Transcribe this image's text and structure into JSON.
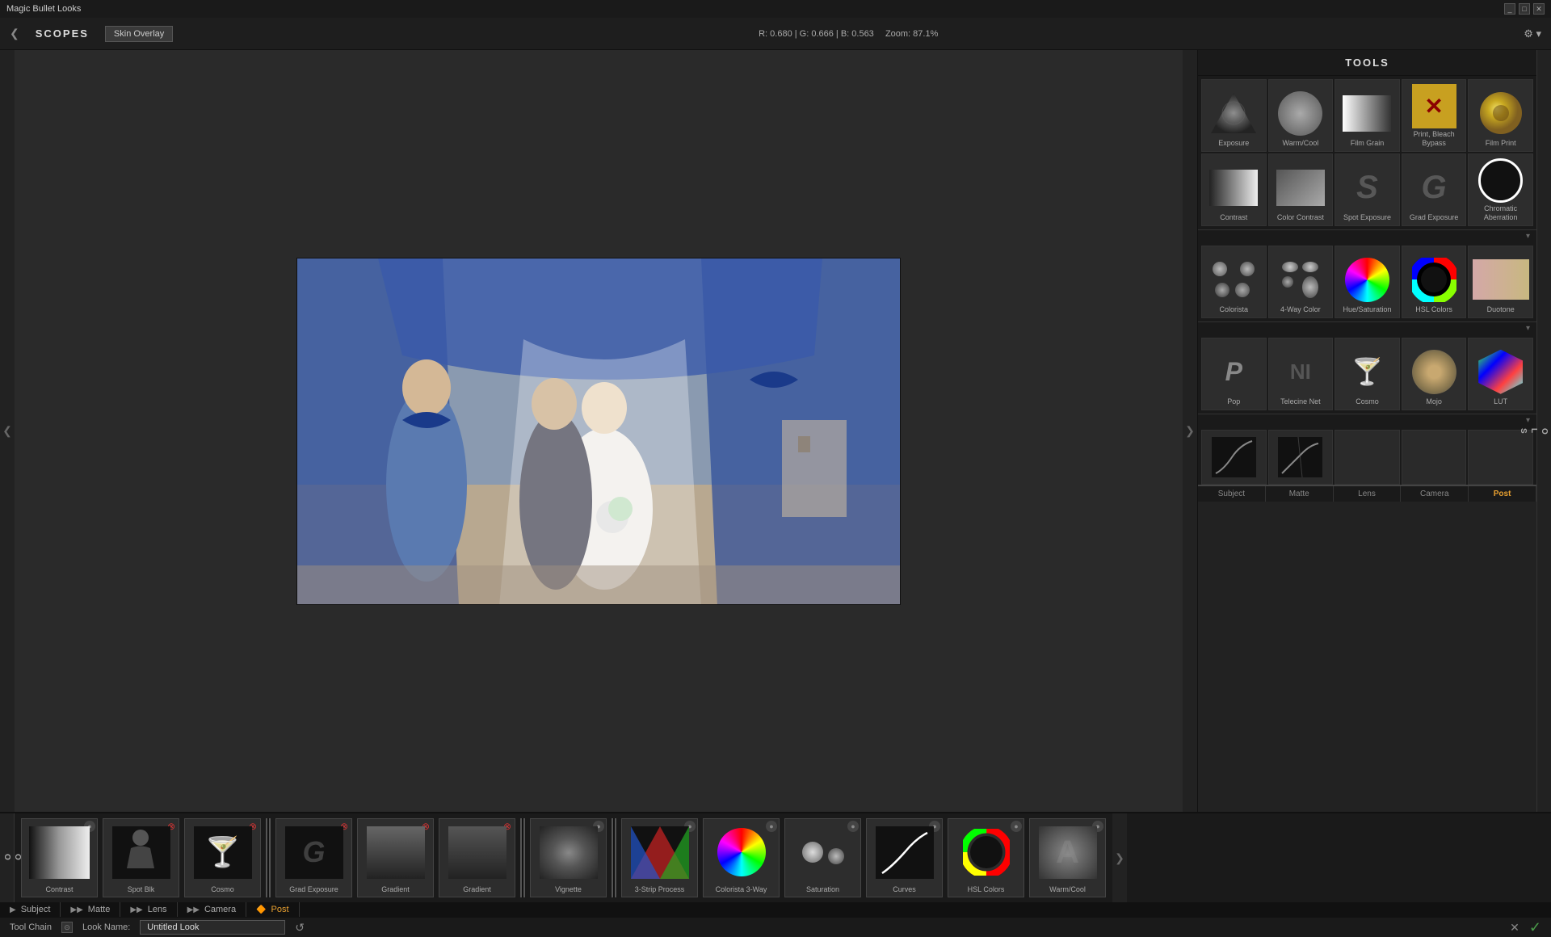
{
  "titleBar": {
    "title": "Magic Bullet Looks",
    "controls": [
      "_",
      "□",
      "✕"
    ]
  },
  "topBar": {
    "scopes": "SCOPES",
    "skinOverlay": "Skin Overlay",
    "rgbInfo": "R: 0.680 | G: 0.666 | B: 0.563",
    "zoom": "Zoom: 87.1%",
    "navLeft": "❮"
  },
  "tools": {
    "header": "TOOLS",
    "row1": [
      {
        "label": "Exposure"
      },
      {
        "label": "Warm/Cool"
      },
      {
        "label": "Film Grain"
      },
      {
        "label": "Print, Bleach Bypass"
      },
      {
        "label": "Film Print"
      }
    ],
    "row2": [
      {
        "label": "Contrast"
      },
      {
        "label": "Color Contrast"
      },
      {
        "label": "Spot Exposure"
      },
      {
        "label": "Grad Exposure"
      },
      {
        "label": "Chromatic Aberration"
      }
    ],
    "row3": [
      {
        "label": "Colorista"
      },
      {
        "label": "4-Way Color"
      },
      {
        "label": "Hue/Saturation"
      },
      {
        "label": "HSL Colors"
      },
      {
        "label": "Duotone"
      }
    ],
    "row4": [
      {
        "label": "Pop"
      },
      {
        "label": "Telecine Net"
      },
      {
        "label": "Cosmo"
      },
      {
        "label": "Mojo"
      },
      {
        "label": "LUT"
      }
    ],
    "sectionLabels": [
      {
        "label": "Subject",
        "active": false
      },
      {
        "label": "Matte",
        "active": false
      },
      {
        "label": "Lens",
        "active": false
      },
      {
        "label": "Camera",
        "active": false
      },
      {
        "label": "Post",
        "active": true
      }
    ]
  },
  "timeline": {
    "items": [
      {
        "label": "Contrast",
        "type": "contrast"
      },
      {
        "label": "Spot Blk",
        "type": "spot"
      },
      {
        "label": "Cosmo",
        "type": "cosmo"
      },
      {
        "label": "Grad Exposure",
        "type": "grad"
      },
      {
        "label": "Gradient",
        "type": "gradient"
      },
      {
        "label": "Gradient",
        "type": "gradient"
      },
      {
        "label": "Vignette",
        "type": "vignette"
      },
      {
        "label": "3-Strip Process",
        "type": "3strip"
      },
      {
        "label": "Colorista 3-Way",
        "type": "colorista3"
      },
      {
        "label": "Saturation",
        "type": "saturation"
      },
      {
        "label": "Curves",
        "type": "curves"
      },
      {
        "label": "HSL Colors",
        "type": "hsl"
      },
      {
        "label": "Warm/Cool",
        "type": "warmcool"
      }
    ],
    "sections": [
      "Subject",
      "Matte",
      "Lens",
      "Camera",
      "Post"
    ],
    "activeSection": "Post"
  },
  "toolchain": {
    "label": "Tool Chain",
    "lookNameLabel": "Look Name:",
    "lookName": "Untitled Look",
    "resetIcon": "↺"
  }
}
